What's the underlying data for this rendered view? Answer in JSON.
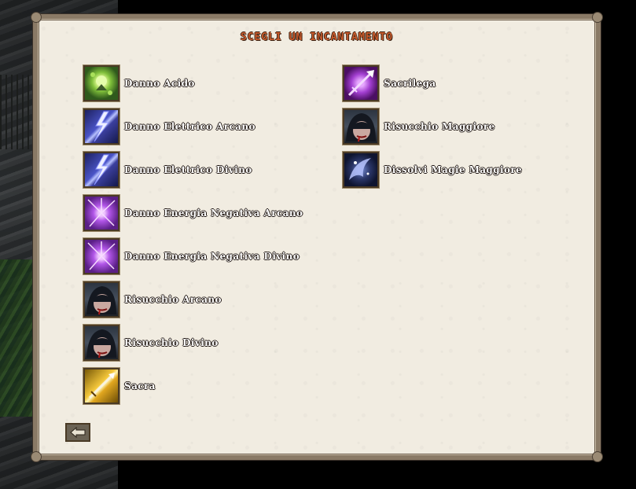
{
  "dialog": {
    "title": "SCEGLI UN INCANTAMENTO"
  },
  "left_column": [
    {
      "label": "Danno Acido",
      "icon": "acid-damage-icon"
    },
    {
      "label": "Danno Elettrico Arcano",
      "icon": "lightning-icon"
    },
    {
      "label": "Danno Elettrico Divino",
      "icon": "lightning-icon"
    },
    {
      "label": "Danno Energia Negativa Arcano",
      "icon": "negative-energy-icon"
    },
    {
      "label": "Danno Energia Negativa Divino",
      "icon": "negative-energy-icon"
    },
    {
      "label": "Risucchio Arcano",
      "icon": "hooded-vampire-icon"
    },
    {
      "label": "Risucchio Divino",
      "icon": "hooded-vampire-icon"
    },
    {
      "label": "Sacra",
      "icon": "holy-weapon-icon"
    }
  ],
  "right_column": [
    {
      "label": "Sacrilega",
      "icon": "unholy-weapon-icon"
    },
    {
      "label": "Risucchio Maggiore",
      "icon": "hooded-vampire-icon"
    },
    {
      "label": "Dissolvi Magie Maggiore",
      "icon": "dispel-magic-icon"
    }
  ],
  "back_button": {
    "icon": "back-arrow-icon"
  }
}
